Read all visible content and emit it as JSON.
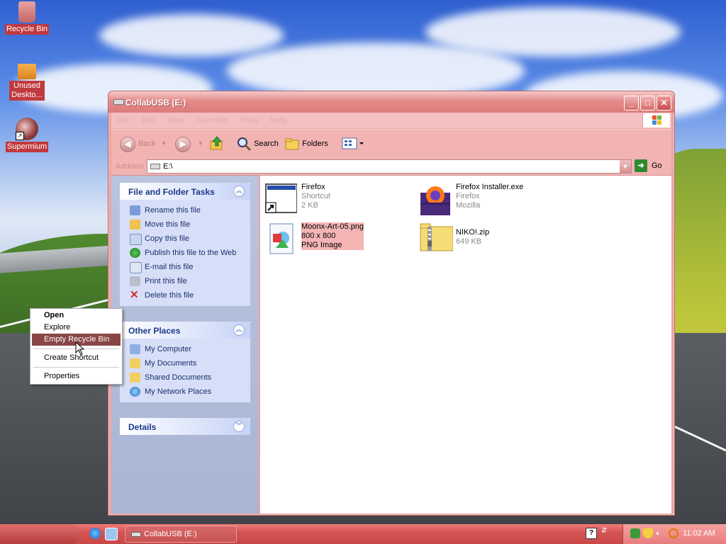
{
  "desktop": {
    "icons": [
      {
        "label": "Recycle Bin"
      },
      {
        "label": "Unused Deskto..."
      },
      {
        "label": "Supermium"
      }
    ]
  },
  "window": {
    "title": "CollabUSB (E:)",
    "menu": [
      "File",
      "Edit",
      "View",
      "Favorites",
      "Tools",
      "Help"
    ],
    "toolbar": {
      "back": "Back",
      "search": "Search",
      "folders": "Folders"
    },
    "address": {
      "label": "Address",
      "value": "E:\\",
      "go": "Go"
    },
    "file_tasks": {
      "title": "File and Folder Tasks",
      "items": [
        "Rename this file",
        "Move this file",
        "Copy this file",
        "Publish this file to the Web",
        "E-mail this file",
        "Print this file",
        "Delete this file"
      ]
    },
    "other_places": {
      "title": "Other Places",
      "items": [
        "My Computer",
        "My Documents",
        "Shared Documents",
        "My Network Places"
      ]
    },
    "details": {
      "title": "Details"
    },
    "files": [
      {
        "name": "Firefox",
        "line2": "Shortcut",
        "line3": "2 KB"
      },
      {
        "name": "Firefox Installer.exe",
        "line2": "Firefox",
        "line3": "Mozilla"
      },
      {
        "name": "Moonx-Art-05.png",
        "line2": "800 x 800",
        "line3": "PNG Image"
      },
      {
        "name": "NIKO!.zip",
        "line2": "649 KB",
        "line3": ""
      }
    ]
  },
  "context_menu": {
    "items": [
      "Open",
      "Explore",
      "Empty Recycle Bin",
      "Create Shortcut",
      "Properties"
    ],
    "highlighted": "Empty Recycle Bin"
  },
  "taskbar": {
    "task_label": "CollabUSB (E:)",
    "clock": "11:02 AM"
  },
  "colors": {
    "accent": "#d45454",
    "highlight": "#8a4545",
    "selection": "#f5b5b5"
  }
}
